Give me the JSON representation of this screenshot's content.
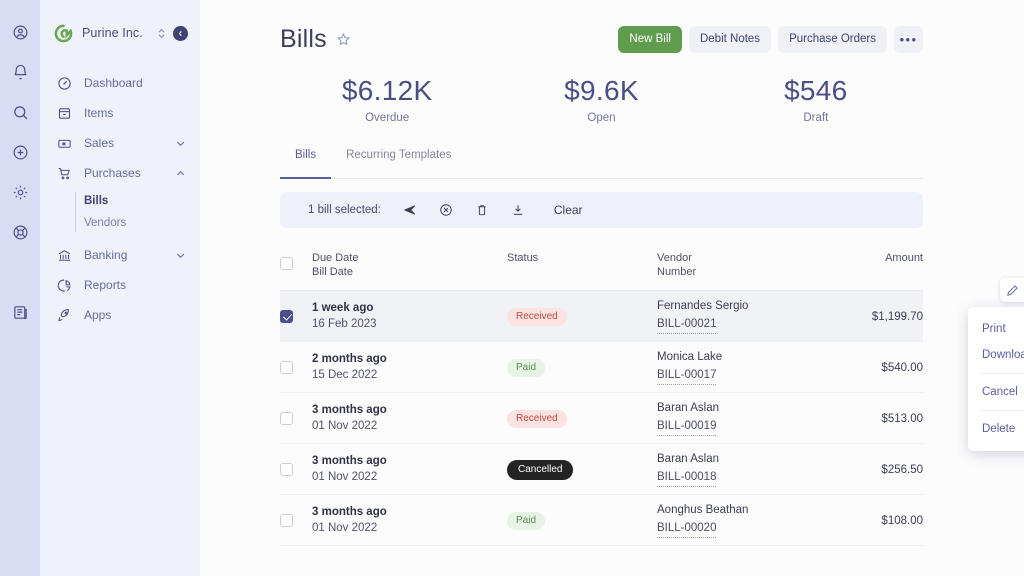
{
  "rail": {
    "icons": [
      {
        "name": "account-icon"
      },
      {
        "name": "bell-icon"
      },
      {
        "name": "search-icon"
      },
      {
        "name": "plus-circle-icon"
      },
      {
        "name": "gear-icon"
      },
      {
        "name": "lifebuoy-icon"
      },
      {
        "name": "book-icon"
      }
    ]
  },
  "sidebar": {
    "brand": "Purine Inc.",
    "switcher_icon": "chevron-updown-icon",
    "collapse_icon": "chevron-left-icon",
    "items": [
      {
        "label": "Dashboard",
        "icon": "gauge-icon",
        "chevron": null
      },
      {
        "label": "Items",
        "icon": "box-icon",
        "chevron": null
      },
      {
        "label": "Sales",
        "icon": "cash-icon",
        "chevron": "down"
      },
      {
        "label": "Purchases",
        "icon": "cart-icon",
        "chevron": "up"
      }
    ],
    "sub_items": [
      {
        "label": "Bills",
        "active": true
      },
      {
        "label": "Vendors",
        "active": false
      }
    ],
    "items_after": [
      {
        "label": "Banking",
        "icon": "bank-icon",
        "chevron": "down"
      },
      {
        "label": "Reports",
        "icon": "piechart-icon",
        "chevron": null
      },
      {
        "label": "Apps",
        "icon": "rocket-icon",
        "chevron": null
      }
    ]
  },
  "header": {
    "title": "Bills",
    "star_icon": "star-icon",
    "buttons": [
      {
        "label": "New Bill",
        "style": "primary",
        "name": "new-bill-button"
      },
      {
        "label": "Debit Notes",
        "style": "ghost",
        "name": "debit-notes-button"
      },
      {
        "label": "Purchase Orders",
        "style": "ghost",
        "name": "purchase-orders-button"
      }
    ],
    "more_label": "•••"
  },
  "kpis": [
    {
      "value": "$6.12K",
      "label": "Overdue"
    },
    {
      "value": "$9.6K",
      "label": "Open"
    },
    {
      "value": "$546",
      "label": "Draft"
    }
  ],
  "tabs": [
    {
      "label": "Bills",
      "active": true
    },
    {
      "label": "Recurring Templates",
      "active": false
    }
  ],
  "selection_bar": {
    "text": "1 bill selected:",
    "actions": [
      {
        "name": "send-icon"
      },
      {
        "name": "cancel-circle-icon"
      },
      {
        "name": "trash-icon"
      },
      {
        "name": "download-icon"
      }
    ],
    "clear_label": "Clear"
  },
  "table": {
    "headers": {
      "due_date": "Due Date",
      "bill_date": "Bill Date",
      "status": "Status",
      "vendor": "Vendor",
      "number": "Number",
      "amount": "Amount"
    },
    "rows": [
      {
        "checked": true,
        "due": "1 week ago",
        "date": "16 Feb 2023",
        "status": "Received",
        "status_kind": "received",
        "vendor": "Fernandes Sergio",
        "number": "BILL-00021",
        "amount": "$1,199.70"
      },
      {
        "checked": false,
        "due": "2 months ago",
        "date": "15 Dec 2022",
        "status": "Paid",
        "status_kind": "paid",
        "vendor": "Monica Lake",
        "number": "BILL-00017",
        "amount": "$540.00"
      },
      {
        "checked": false,
        "due": "3 months ago",
        "date": "01 Nov 2022",
        "status": "Received",
        "status_kind": "received",
        "vendor": "Baran Aslan",
        "number": "BILL-00019",
        "amount": "$513.00"
      },
      {
        "checked": false,
        "due": "3 months ago",
        "date": "01 Nov 2022",
        "status": "Cancelled",
        "status_kind": "cancelled",
        "vendor": "Baran Aslan",
        "number": "BILL-00018",
        "amount": "$256.50"
      },
      {
        "checked": false,
        "due": "3 months ago",
        "date": "01 Nov 2022",
        "status": "Paid",
        "status_kind": "paid",
        "vendor": "Aonghus Beathan",
        "number": "BILL-00020",
        "amount": "$108.00"
      }
    ]
  },
  "row_actions": [
    {
      "name": "edit-pencil-icon"
    },
    {
      "name": "copy-icon"
    },
    {
      "name": "record-payment-icon"
    },
    {
      "name": "more-icon",
      "label": "•••"
    }
  ],
  "context_menu": {
    "items": [
      {
        "label": "Print",
        "sep_after": false
      },
      {
        "label": "Download PDF",
        "sep_after": true
      },
      {
        "label": "Cancel",
        "sep_after": true
      },
      {
        "label": "Delete",
        "sep_after": false
      }
    ]
  },
  "colors": {
    "primary_green": "#5f9c4e",
    "accent_indigo": "#5a5ea0",
    "rail_bg": "#d8ddf4",
    "sidebar_bg": "#eff2fb",
    "received_bg": "#fbe3e2",
    "received_fg": "#c4483f",
    "paid_bg": "#e7f3e4",
    "paid_fg": "#5e8b51",
    "cancelled_bg": "#242424"
  }
}
